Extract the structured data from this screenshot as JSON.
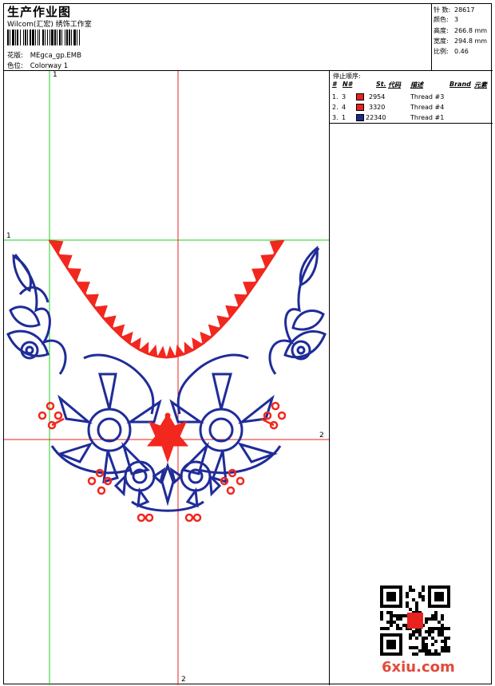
{
  "header": {
    "title": "生产作业图",
    "company": "Wilcom(汇宏) 绣饰工作室",
    "design_label": "花版:",
    "design_value": "MEgca_gp.EMB",
    "colorway_label": "色位:",
    "colorway_value": "Colorway 1"
  },
  "stats": [
    {
      "label": "针 数:",
      "value": "28617"
    },
    {
      "label": "颜色:",
      "value": "3"
    },
    {
      "label": "高度:",
      "value": "266.8 mm"
    },
    {
      "label": "宽度:",
      "value": "294.8 mm"
    },
    {
      "label": "比例:",
      "value": "0.46"
    }
  ],
  "legend": {
    "title": "停止顺序:",
    "headers": {
      "num": "#",
      "n": "N#",
      "st": "St.",
      "code": "代码",
      "desc": "描述",
      "brand": "Brand",
      "element": "元素"
    },
    "rows": [
      {
        "num": "1.",
        "n": "3",
        "code": "2954",
        "desc": "Thread #3",
        "color": "#e8231e"
      },
      {
        "num": "2.",
        "n": "4",
        "code": "3320",
        "desc": "Thread #4",
        "color": "#e8231e"
      },
      {
        "num": "3.",
        "n": "1",
        "code": "22340",
        "desc": "Thread #1",
        "color": "#1b2b8c"
      }
    ]
  },
  "axes": {
    "v1_top": "1",
    "h1_left": "1",
    "h2_right": "2",
    "v2_bottom": "2"
  },
  "colors": {
    "thread_red": "#f2271e",
    "thread_blue": "#1f2c98",
    "guide_green": "#22cc22",
    "guide_red": "#e8231e"
  },
  "watermark": "6xiu.com",
  "qr_icon": "qr-code-icon"
}
